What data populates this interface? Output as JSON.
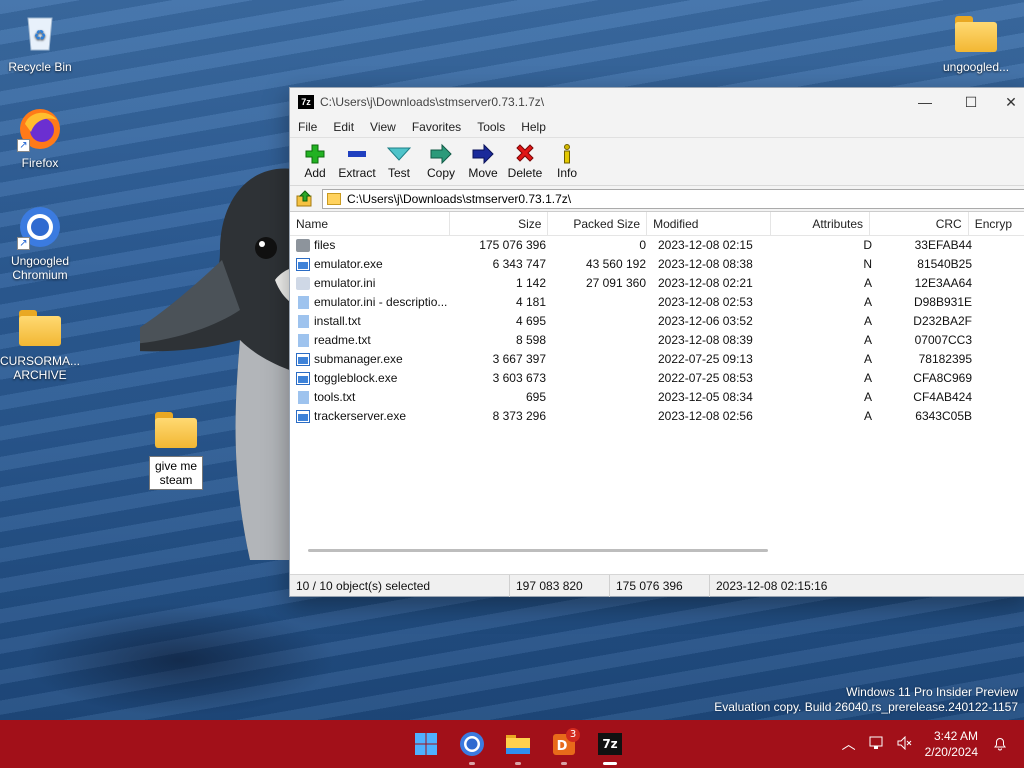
{
  "desktop": {
    "icons": [
      {
        "label": "Recycle Bin"
      },
      {
        "label": "Firefox"
      },
      {
        "label": "Ungoogled Chromium"
      },
      {
        "label": "CURSORMA... ARCHIVE"
      },
      {
        "label": "give me steam"
      },
      {
        "label": "ungoogled..."
      }
    ],
    "watermark_line1": "Windows 11 Pro Insider Preview",
    "watermark_line2": "Evaluation copy. Build 26040.rs_prerelease.240122-1157"
  },
  "window": {
    "app_icon_text": "7z",
    "title": "C:\\Users\\j\\Downloads\\stmserver0.73.1.7z\\",
    "menu": [
      "File",
      "Edit",
      "View",
      "Favorites",
      "Tools",
      "Help"
    ],
    "toolbar": [
      "Add",
      "Extract",
      "Test",
      "Copy",
      "Move",
      "Delete",
      "Info"
    ],
    "address": "C:\\Users\\j\\Downloads\\stmserver0.73.1.7z\\",
    "columns": [
      "Name",
      "Size",
      "Packed Size",
      "Modified",
      "Attributes",
      "CRC",
      "Encryp"
    ],
    "rows": [
      {
        "type": "folder",
        "name": "files",
        "size": "175 076 396",
        "packed": "0",
        "modified": "2023-12-08 02:15",
        "attr": "D",
        "crc": "33EFAB44"
      },
      {
        "type": "exe",
        "name": "emulator.exe",
        "size": "6 343 747",
        "packed": "43 560 192",
        "modified": "2023-12-08 08:38",
        "attr": "N",
        "crc": "81540B25"
      },
      {
        "type": "ini",
        "name": "emulator.ini",
        "size": "1 142",
        "packed": "27 091 360",
        "modified": "2023-12-08 02:21",
        "attr": "A",
        "crc": "12E3AA64"
      },
      {
        "type": "txt",
        "name": "emulator.ini - descriptio...",
        "size": "4 181",
        "packed": "",
        "modified": "2023-12-08 02:53",
        "attr": "A",
        "crc": "D98B931E"
      },
      {
        "type": "txt",
        "name": "install.txt",
        "size": "4 695",
        "packed": "",
        "modified": "2023-12-06 03:52",
        "attr": "A",
        "crc": "D232BA2F"
      },
      {
        "type": "txt",
        "name": "readme.txt",
        "size": "8 598",
        "packed": "",
        "modified": "2023-12-08 08:39",
        "attr": "A",
        "crc": "07007CC3"
      },
      {
        "type": "exe",
        "name": "submanager.exe",
        "size": "3 667 397",
        "packed": "",
        "modified": "2022-07-25 09:13",
        "attr": "A",
        "crc": "78182395"
      },
      {
        "type": "exe",
        "name": "toggleblock.exe",
        "size": "3 603 673",
        "packed": "",
        "modified": "2022-07-25 08:53",
        "attr": "A",
        "crc": "CFA8C969"
      },
      {
        "type": "txt",
        "name": "tools.txt",
        "size": "695",
        "packed": "",
        "modified": "2023-12-05 08:34",
        "attr": "A",
        "crc": "CF4AB424"
      },
      {
        "type": "exe",
        "name": "trackerserver.exe",
        "size": "8 373 296",
        "packed": "",
        "modified": "2023-12-08 02:56",
        "attr": "A",
        "crc": "6343C05B"
      }
    ],
    "status": {
      "selected": "10 / 10 object(s) selected",
      "size": "197 083 820",
      "packed": "175 076 396",
      "modified": "2023-12-08 02:15:16"
    }
  },
  "taskbar": {
    "badge_count": "3",
    "zip_label": "7z",
    "time": "3:42 AM",
    "date": "2/20/2024"
  }
}
